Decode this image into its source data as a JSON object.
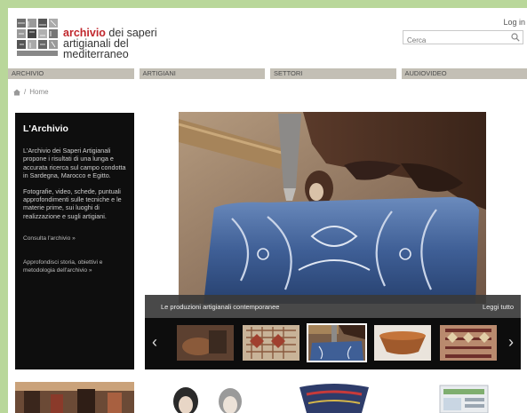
{
  "header": {
    "logo_red": "archivio",
    "logo_line1_rest": " dei saperi",
    "logo_line2": "artigianali del",
    "logo_line3": "mediterraneo",
    "login": "Log in",
    "search_placeholder": "Cerca"
  },
  "nav": {
    "items": [
      {
        "label": "ARCHIVIO"
      },
      {
        "label": "ARTIGIANI"
      },
      {
        "label": "SETTORI"
      },
      {
        "label": "AUDIOVIDEO"
      }
    ]
  },
  "breadcrumb": {
    "home_label": "Home"
  },
  "sidebar": {
    "title": "L'Archivio",
    "para1": "L'Archivio dei Saperi Artigianali propone i risultati di una lunga e accurata ricerca sul campo condotta in Sardegna, Marocco e Egitto.",
    "para2": "Fotografie, video, schede, puntuali approfondimenti sulle tecniche e le materie prime, sui luoghi di realizzazione e sugli artigiani.",
    "link1": "Consulta l'archivio »",
    "link2": "Approfondisci storia, obiettivi e metodologia dell'archivio »"
  },
  "slideshow": {
    "caption": "Le produzioni artigianali contemporanee",
    "more_link": "Leggi tutto",
    "prev_arrow": "‹",
    "next_arrow": "›"
  },
  "colors": {
    "page_border": "#b9d79a",
    "brand_red": "#c0272d",
    "nav_bg": "#c3bfb5",
    "sidebar_bg": "#0e0e0e"
  }
}
